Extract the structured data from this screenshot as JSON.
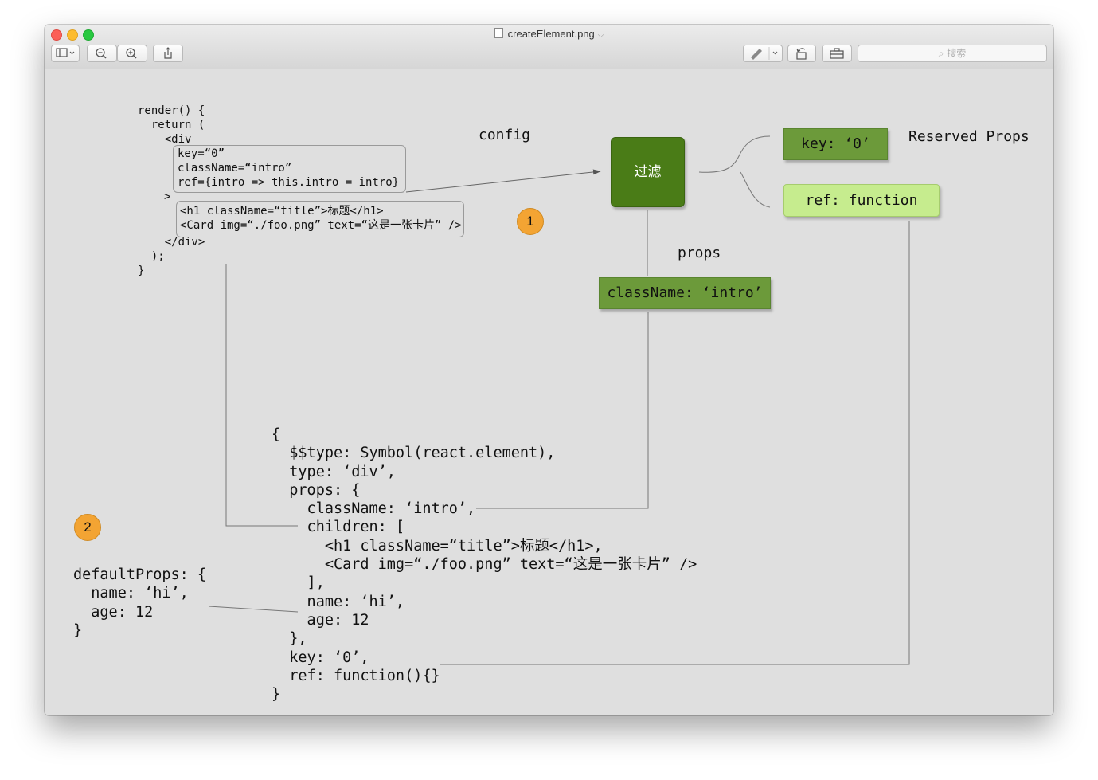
{
  "window": {
    "title": "createElement.png",
    "search_placeholder": "搜索"
  },
  "toolbar": {
    "sidebar_icon": "sidebar-icon",
    "zoom_out_icon": "zoom-out-icon",
    "zoom_in_icon": "zoom-in-icon",
    "share_icon": "share-icon",
    "markup_icon": "pen-icon",
    "rotate_icon": "rotate-icon",
    "toolbox_icon": "toolbox-icon"
  },
  "diagram": {
    "render_code": {
      "lines_before": "render() {\n  return (\n    <div",
      "config_attrs": "key=“0”\nclassName=“intro”\nref={intro => this.intro = intro}",
      "gt": ">",
      "children": "<h1 className=“title”>标题</h1>\n<Card img=“./foo.png” text=“这是一张卡片” />",
      "lines_after": "    </div>\n  );\n}"
    },
    "config_label": "config",
    "filter_label": "过滤",
    "reserved_key": "key: ‘0’",
    "reserved_ref": "ref: function",
    "reserved_title": "Reserved Props",
    "props_label": "props",
    "classname_prop": "className: ‘intro’",
    "badge1": "1",
    "badge2": "2",
    "default_props": "defaultProps: {\n  name: ‘hi’,\n  age: 12\n}",
    "element_object": "{\n  $$type: Symbol(react.element),\n  type: ‘div’,\n  props: {\n    className: ‘intro’,\n    children: [\n      <h1 className=“title”>标题</h1>,\n      <Card img=“./foo.png” text=“这是一张卡片” />\n    ],\n    name: ‘hi’,\n    age: 12\n  },\n  key: ‘0’,\n  ref: function(){}\n}"
  },
  "colors": {
    "canvas": "#dfdfdf",
    "filter_green": "#4a7c17",
    "mid_green": "#6c9a3a",
    "light_green": "#c6ec8e",
    "badge_orange": "#f3a433"
  }
}
